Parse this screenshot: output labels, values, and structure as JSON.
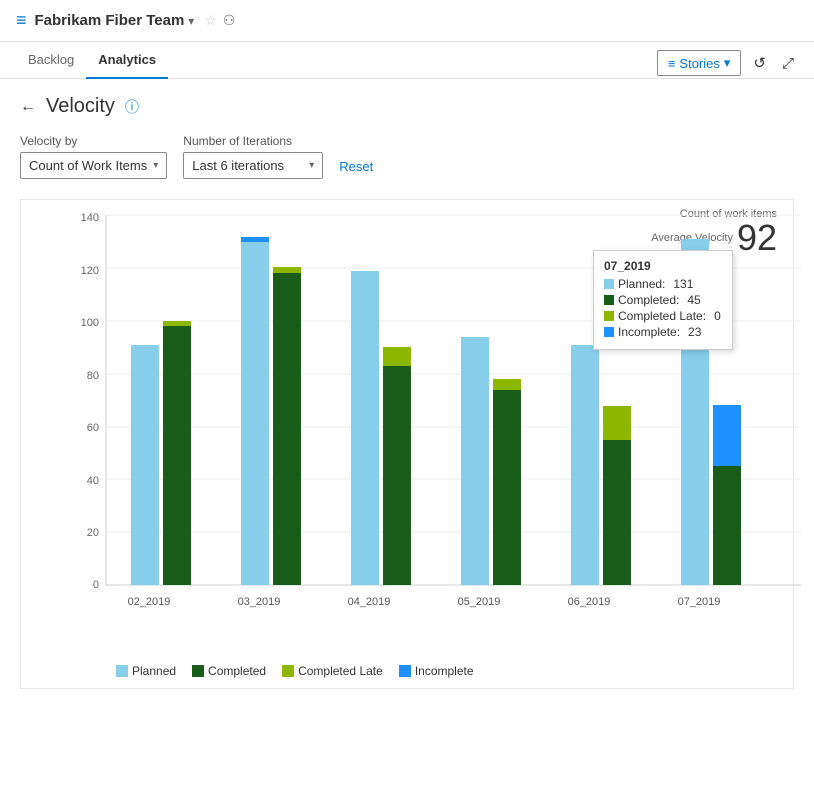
{
  "header": {
    "team_name": "Fabrikam Fiber Team",
    "chevron": "▾",
    "star": "☆",
    "people_icon": "⚇"
  },
  "nav": {
    "tabs": [
      {
        "id": "backlog",
        "label": "Backlog",
        "active": false
      },
      {
        "id": "analytics",
        "label": "Analytics",
        "active": true
      }
    ],
    "stories_btn": "Stories",
    "stories_chevron": "▾"
  },
  "page": {
    "title": "Velocity",
    "back_arrow": "←"
  },
  "filters": {
    "velocity_by_label": "Velocity by",
    "velocity_by_value": "Count of Work Items",
    "iterations_label": "Number of Iterations",
    "iterations_value": "Last 6 iterations",
    "reset_label": "Reset"
  },
  "chart": {
    "velocity_label1": "Count of work items",
    "velocity_label2": "Average Velocity",
    "velocity_value": "92",
    "y_labels": [
      "0",
      "20",
      "40",
      "60",
      "80",
      "100",
      "120",
      "140"
    ],
    "x_labels": [
      "02_2019",
      "03_2019",
      "04_2019",
      "05_2019",
      "06_2019",
      "07_2019"
    ],
    "colors": {
      "planned": "#87CEEB",
      "completed": "#1a5c1a",
      "completed_late": "#8db600",
      "incomplete": "#1e90ff"
    },
    "bars": [
      {
        "sprint": "02_2019",
        "planned": 91,
        "completed": 98,
        "completed_late": 2,
        "incomplete": 0
      },
      {
        "sprint": "03_2019",
        "planned": 130,
        "completed": 118,
        "completed_late": 2,
        "incomplete": 0
      },
      {
        "sprint": "04_2019",
        "planned": 119,
        "completed": 83,
        "completed_late": 90,
        "incomplete": 0
      },
      {
        "sprint": "05_2019",
        "planned": 94,
        "completed": 74,
        "completed_late": 78,
        "incomplete": 0
      },
      {
        "sprint": "06_2019",
        "planned": 91,
        "completed": 55,
        "completed_late": 68,
        "incomplete": 0
      },
      {
        "sprint": "07_2019",
        "planned": 131,
        "completed": 45,
        "completed_late": 0,
        "incomplete": 23
      }
    ],
    "tooltip": {
      "sprint": "07_2019",
      "planned_label": "Planned:",
      "planned_value": "131",
      "completed_label": "Completed:",
      "completed_value": "45",
      "completed_late_label": "Completed Late:",
      "completed_late_value": "0",
      "incomplete_label": "Incomplete:",
      "incomplete_value": "23"
    }
  },
  "legend": {
    "items": [
      {
        "id": "planned",
        "label": "Planned",
        "color": "#87CEEB"
      },
      {
        "id": "completed",
        "label": "Completed",
        "color": "#1a5c1a"
      },
      {
        "id": "completed_late",
        "label": "Completed Late",
        "color": "#8db600"
      },
      {
        "id": "incomplete",
        "label": "Incomplete",
        "color": "#1e90ff"
      }
    ]
  }
}
